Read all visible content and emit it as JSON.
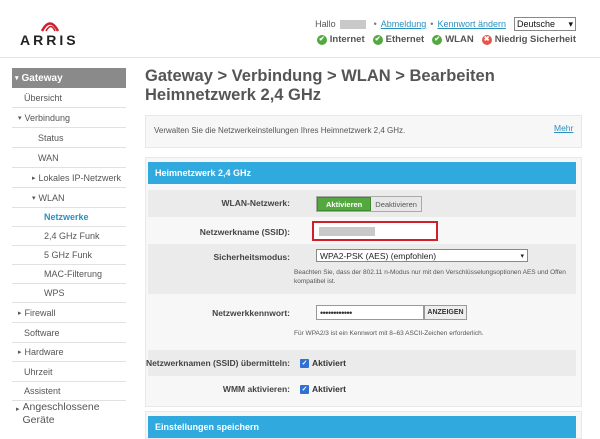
{
  "brand": "ARRIS",
  "header": {
    "greeting": "Hallo",
    "logout": "Abmeldung",
    "change_password": "Kennwort ändern",
    "separator": "•",
    "language": "Deutsche",
    "status": [
      {
        "label": "Internet",
        "state": "ok"
      },
      {
        "label": "Ethernet",
        "state": "ok"
      },
      {
        "label": "WLAN",
        "state": "ok"
      },
      {
        "label": "Niedrig Sicherheit",
        "state": "bad"
      }
    ]
  },
  "sidebar": {
    "items": [
      {
        "label": "Gateway"
      },
      {
        "label": "Übersicht"
      },
      {
        "label": "Verbindung"
      },
      {
        "label": "Status"
      },
      {
        "label": "WAN"
      },
      {
        "label": "Lokales IP-Netzwerk"
      },
      {
        "label": "WLAN"
      },
      {
        "label": "Netzwerke"
      },
      {
        "label": "2,4 GHz Funk"
      },
      {
        "label": "5 GHz Funk"
      },
      {
        "label": "MAC-Filterung"
      },
      {
        "label": "WPS"
      },
      {
        "label": "Firewall"
      },
      {
        "label": "Software"
      },
      {
        "label": "Hardware"
      },
      {
        "label": "Uhrzeit"
      },
      {
        "label": "Assistent"
      },
      {
        "label": "Angeschlossene"
      },
      {
        "label": "Geräte"
      }
    ]
  },
  "main": {
    "title_line1": "Gateway > Verbindung > WLAN > Bearbeiten",
    "title_line2": "Heimnetzwerk 2,4 GHz",
    "info": "Verwalten Sie die Netzwerkeinstellungen Ihres Heimnetzwerk 2,4 GHz.",
    "more": "Mehr",
    "section_title": "Heimnetzwerk 2,4 GHz",
    "wlan_label": "WLAN-Netzwerk:",
    "toggle_on": "Aktivieren",
    "toggle_off": "Deaktivieren",
    "ssid_label": "Netzwerkname (SSID):",
    "security_label": "Sicherheitsmodus:",
    "security_value": "WPA2-PSK (AES) (empfohlen)",
    "security_note_1": "Beachten Sie, dass der 802.11 n-Modus nur mit den Verschlüsselungsoptionen AES und Offen",
    "security_note_2": "kompatibel ist.",
    "password_label": "Netzwerkkennwort:",
    "password_value": "••••••••••••",
    "show_button": "ANZEIGEN",
    "password_note": "Für WPA2/3 ist ein Kennwort mit 8–63 ASCII-Zeichen erforderlich.",
    "broadcast_label": "Netzwerknamen (SSID) übermitteln:",
    "broadcast_value": "Aktiviert",
    "wmm_label": "WMM aktivieren:",
    "wmm_value": "Aktiviert",
    "save_section": "Einstellungen speichern"
  }
}
